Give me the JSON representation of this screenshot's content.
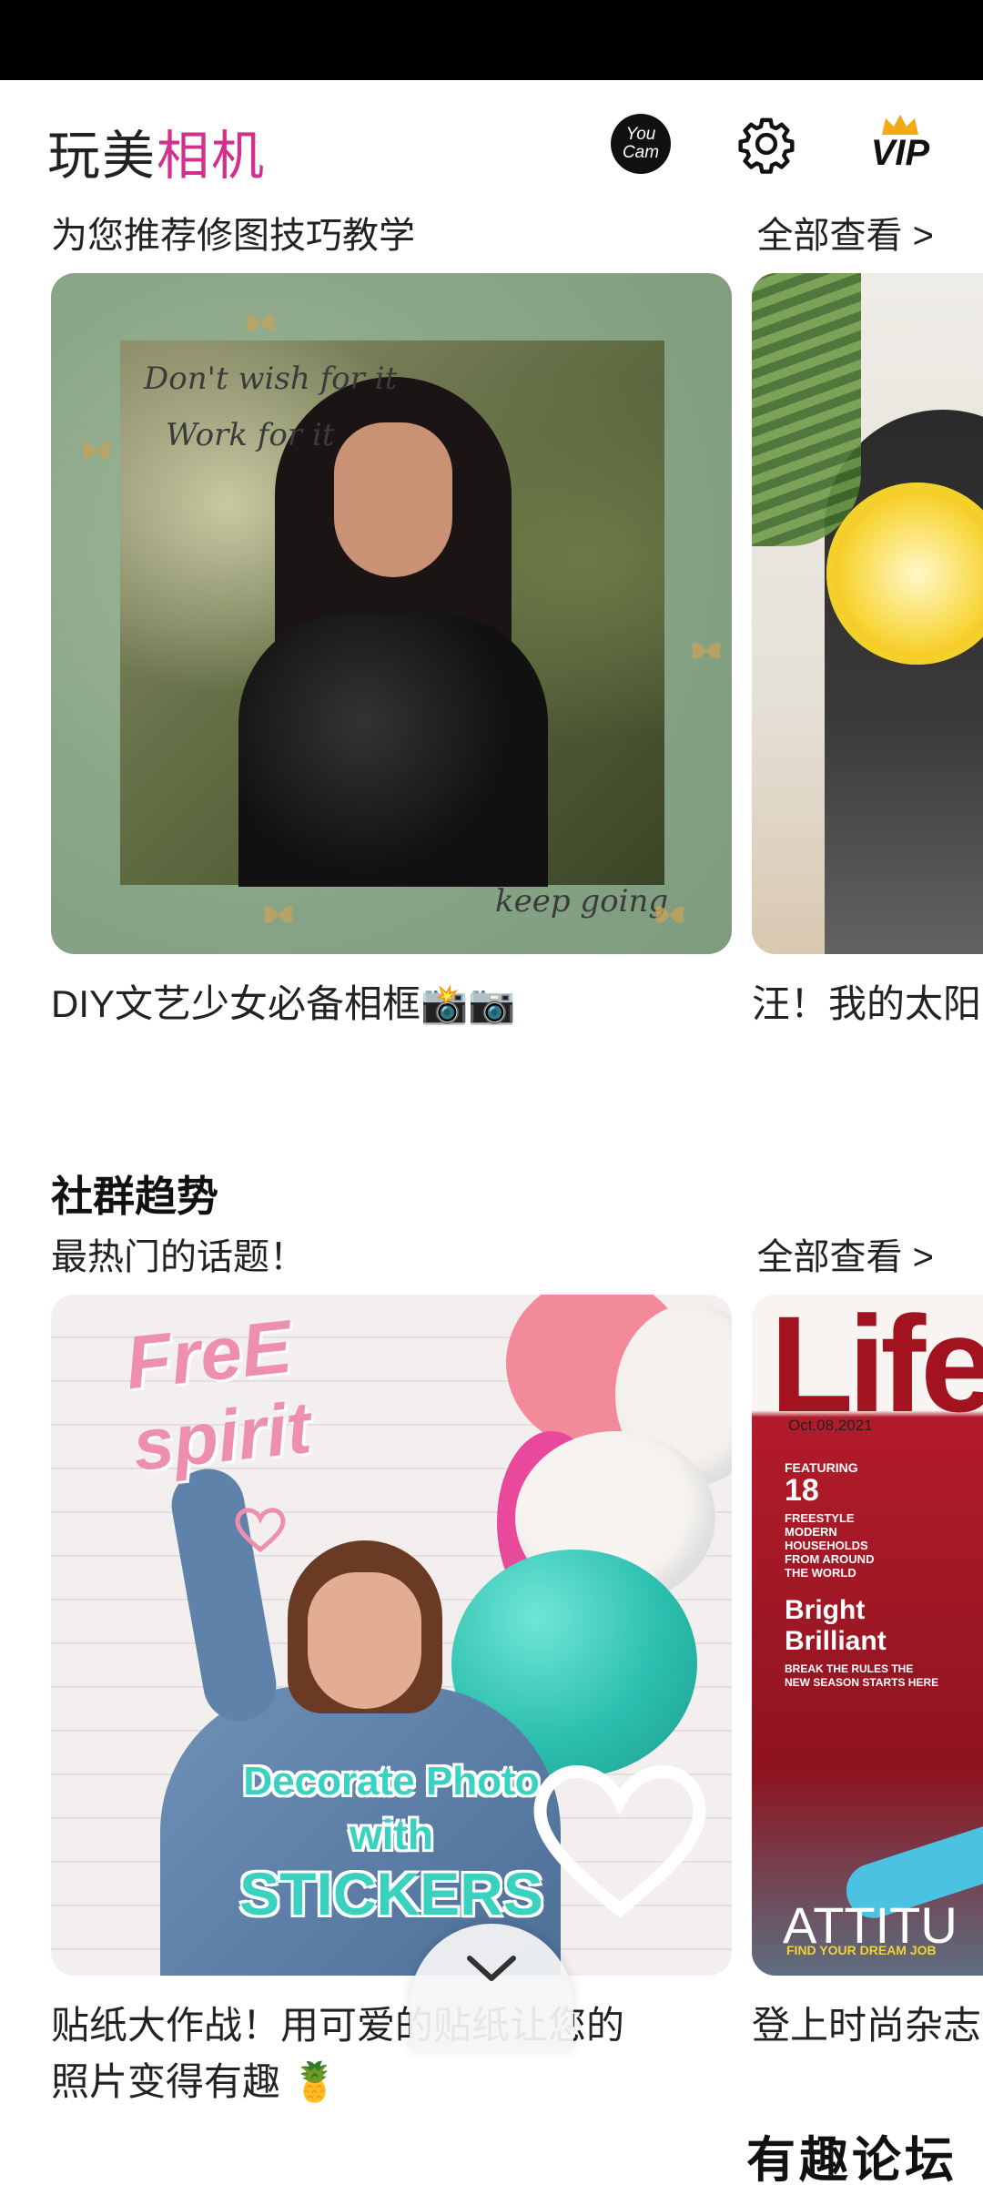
{
  "app": {
    "title_part1": "玩美",
    "title_part2": "相机",
    "accent_color": "#d3308e",
    "youcam_line1": "You",
    "youcam_line2": "Cam",
    "vip_label": "VIP"
  },
  "tutorials": {
    "subtitle": "为您推荐修图技巧教学",
    "view_all": "全部查看 >",
    "cards": [
      {
        "caption": "DIY文艺少女必备相框📸📷",
        "script_line1": "Don't wish for it",
        "script_line2": "Work for it",
        "script_line3": "keep going"
      },
      {
        "caption": "汪！我的太阳"
      }
    ]
  },
  "community": {
    "title": "社群趋势",
    "subtitle": "最热门的话题！",
    "view_all": "全部查看 >",
    "cards": [
      {
        "caption_line1": "贴纸大作战！用可爱的贴纸让您的",
        "caption_line2": "照片变得有趣 🍍",
        "art_free": "FreE",
        "art_spirit": "spirit",
        "art_line1": "Decorate Photo",
        "art_line2": "with",
        "art_line3": "STICKERS"
      },
      {
        "caption": "登上时尚杂志",
        "mag_title": "Life",
        "mag_date": "Oct.08,2021",
        "mag_featuring": "FEATURING",
        "mag_num": "18",
        "mag_lines": "FREESTYLE MODERN HOUSEHOLDS FROM AROUND THE WORLD",
        "mag_bright": "Bright",
        "mag_brilliant": "Brilliant",
        "mag_break": "BREAK THE RULES THE NEW SEASON STARTS HERE",
        "mag_attitude": "ATTITU",
        "mag_find": "FIND YOUR DREAM JOB"
      }
    ]
  },
  "watermark": "有趣论坛"
}
